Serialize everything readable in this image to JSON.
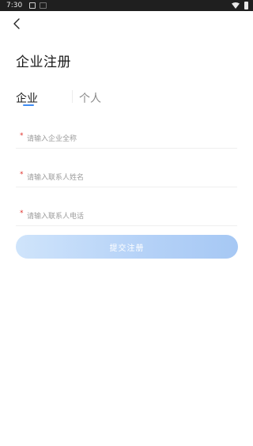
{
  "status_bar": {
    "time": "7:30"
  },
  "header": {
    "back_icon": "chevron-left-icon",
    "title": "企业注册"
  },
  "tabs": [
    {
      "label": "企业",
      "selected": true
    },
    {
      "label": "个人",
      "selected": false
    }
  ],
  "form": {
    "required_mark": "*",
    "fields": [
      {
        "placeholder": "请输入企业全称",
        "value": ""
      },
      {
        "placeholder": "请输入联系人姓名",
        "value": ""
      },
      {
        "placeholder": "请输入联系人电话",
        "value": ""
      }
    ],
    "submit_label": "提交注册"
  },
  "colors": {
    "accent": "#3d8bf2",
    "required": "#e0302a",
    "button_start": "#cfe4fb",
    "button_end": "#a6c8f4"
  }
}
